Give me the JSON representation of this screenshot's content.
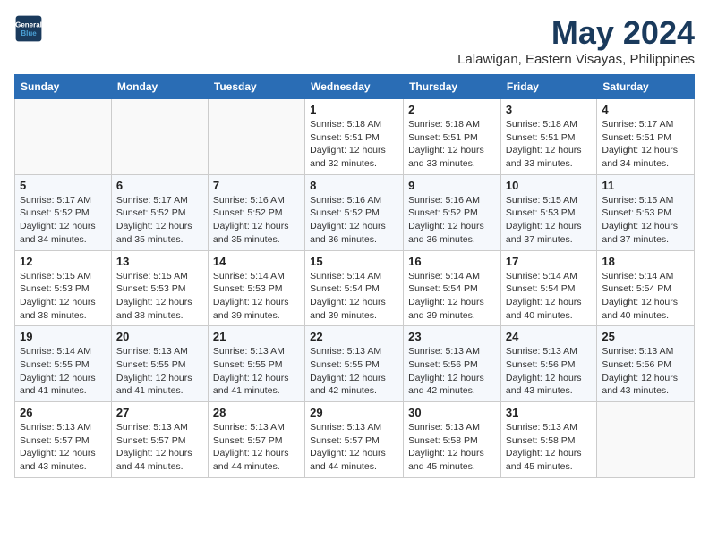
{
  "header": {
    "logo_line1": "General",
    "logo_line2": "Blue",
    "month_title": "May 2024",
    "location": "Lalawigan, Eastern Visayas, Philippines"
  },
  "columns": [
    "Sunday",
    "Monday",
    "Tuesday",
    "Wednesday",
    "Thursday",
    "Friday",
    "Saturday"
  ],
  "weeks": [
    [
      {
        "day": "",
        "info": ""
      },
      {
        "day": "",
        "info": ""
      },
      {
        "day": "",
        "info": ""
      },
      {
        "day": "1",
        "info": "Sunrise: 5:18 AM\nSunset: 5:51 PM\nDaylight: 12 hours\nand 32 minutes."
      },
      {
        "day": "2",
        "info": "Sunrise: 5:18 AM\nSunset: 5:51 PM\nDaylight: 12 hours\nand 33 minutes."
      },
      {
        "day": "3",
        "info": "Sunrise: 5:18 AM\nSunset: 5:51 PM\nDaylight: 12 hours\nand 33 minutes."
      },
      {
        "day": "4",
        "info": "Sunrise: 5:17 AM\nSunset: 5:51 PM\nDaylight: 12 hours\nand 34 minutes."
      }
    ],
    [
      {
        "day": "5",
        "info": "Sunrise: 5:17 AM\nSunset: 5:52 PM\nDaylight: 12 hours\nand 34 minutes."
      },
      {
        "day": "6",
        "info": "Sunrise: 5:17 AM\nSunset: 5:52 PM\nDaylight: 12 hours\nand 35 minutes."
      },
      {
        "day": "7",
        "info": "Sunrise: 5:16 AM\nSunset: 5:52 PM\nDaylight: 12 hours\nand 35 minutes."
      },
      {
        "day": "8",
        "info": "Sunrise: 5:16 AM\nSunset: 5:52 PM\nDaylight: 12 hours\nand 36 minutes."
      },
      {
        "day": "9",
        "info": "Sunrise: 5:16 AM\nSunset: 5:52 PM\nDaylight: 12 hours\nand 36 minutes."
      },
      {
        "day": "10",
        "info": "Sunrise: 5:15 AM\nSunset: 5:53 PM\nDaylight: 12 hours\nand 37 minutes."
      },
      {
        "day": "11",
        "info": "Sunrise: 5:15 AM\nSunset: 5:53 PM\nDaylight: 12 hours\nand 37 minutes."
      }
    ],
    [
      {
        "day": "12",
        "info": "Sunrise: 5:15 AM\nSunset: 5:53 PM\nDaylight: 12 hours\nand 38 minutes."
      },
      {
        "day": "13",
        "info": "Sunrise: 5:15 AM\nSunset: 5:53 PM\nDaylight: 12 hours\nand 38 minutes."
      },
      {
        "day": "14",
        "info": "Sunrise: 5:14 AM\nSunset: 5:53 PM\nDaylight: 12 hours\nand 39 minutes."
      },
      {
        "day": "15",
        "info": "Sunrise: 5:14 AM\nSunset: 5:54 PM\nDaylight: 12 hours\nand 39 minutes."
      },
      {
        "day": "16",
        "info": "Sunrise: 5:14 AM\nSunset: 5:54 PM\nDaylight: 12 hours\nand 39 minutes."
      },
      {
        "day": "17",
        "info": "Sunrise: 5:14 AM\nSunset: 5:54 PM\nDaylight: 12 hours\nand 40 minutes."
      },
      {
        "day": "18",
        "info": "Sunrise: 5:14 AM\nSunset: 5:54 PM\nDaylight: 12 hours\nand 40 minutes."
      }
    ],
    [
      {
        "day": "19",
        "info": "Sunrise: 5:14 AM\nSunset: 5:55 PM\nDaylight: 12 hours\nand 41 minutes."
      },
      {
        "day": "20",
        "info": "Sunrise: 5:13 AM\nSunset: 5:55 PM\nDaylight: 12 hours\nand 41 minutes."
      },
      {
        "day": "21",
        "info": "Sunrise: 5:13 AM\nSunset: 5:55 PM\nDaylight: 12 hours\nand 41 minutes."
      },
      {
        "day": "22",
        "info": "Sunrise: 5:13 AM\nSunset: 5:55 PM\nDaylight: 12 hours\nand 42 minutes."
      },
      {
        "day": "23",
        "info": "Sunrise: 5:13 AM\nSunset: 5:56 PM\nDaylight: 12 hours\nand 42 minutes."
      },
      {
        "day": "24",
        "info": "Sunrise: 5:13 AM\nSunset: 5:56 PM\nDaylight: 12 hours\nand 43 minutes."
      },
      {
        "day": "25",
        "info": "Sunrise: 5:13 AM\nSunset: 5:56 PM\nDaylight: 12 hours\nand 43 minutes."
      }
    ],
    [
      {
        "day": "26",
        "info": "Sunrise: 5:13 AM\nSunset: 5:57 PM\nDaylight: 12 hours\nand 43 minutes."
      },
      {
        "day": "27",
        "info": "Sunrise: 5:13 AM\nSunset: 5:57 PM\nDaylight: 12 hours\nand 44 minutes."
      },
      {
        "day": "28",
        "info": "Sunrise: 5:13 AM\nSunset: 5:57 PM\nDaylight: 12 hours\nand 44 minutes."
      },
      {
        "day": "29",
        "info": "Sunrise: 5:13 AM\nSunset: 5:57 PM\nDaylight: 12 hours\nand 44 minutes."
      },
      {
        "day": "30",
        "info": "Sunrise: 5:13 AM\nSunset: 5:58 PM\nDaylight: 12 hours\nand 45 minutes."
      },
      {
        "day": "31",
        "info": "Sunrise: 5:13 AM\nSunset: 5:58 PM\nDaylight: 12 hours\nand 45 minutes."
      },
      {
        "day": "",
        "info": ""
      }
    ]
  ]
}
